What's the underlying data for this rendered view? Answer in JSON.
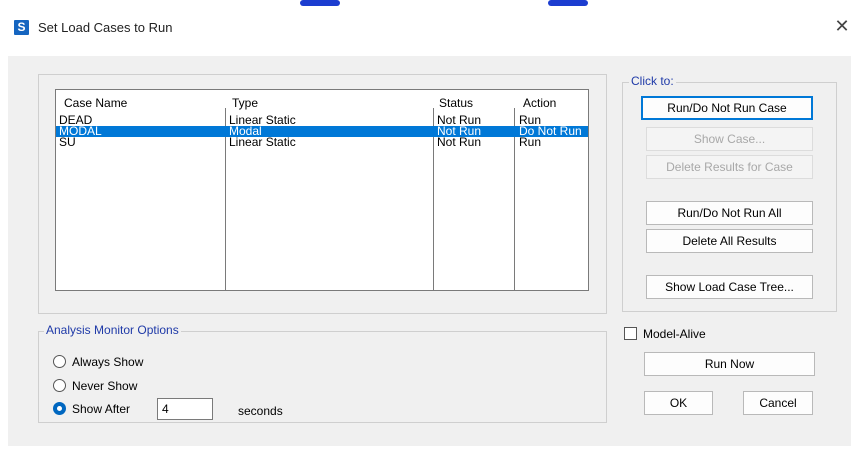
{
  "window": {
    "title": "Set Load Cases to Run",
    "app_icon_letter": "S"
  },
  "table": {
    "headers": [
      "Case Name",
      "Type",
      "Status",
      "Action"
    ],
    "rows": [
      {
        "case_name": "DEAD",
        "type": "Linear Static",
        "status": "Not Run",
        "action": "Run",
        "selected": false
      },
      {
        "case_name": "MODAL",
        "type": "Modal",
        "status": "Not Run",
        "action": "Do Not Run",
        "selected": true
      },
      {
        "case_name": "SU",
        "type": "Linear Static",
        "status": "Not Run",
        "action": "Run",
        "selected": false
      }
    ]
  },
  "click_to": {
    "label": "Click to:",
    "run_do_not_run_case": "Run/Do Not Run Case",
    "show_case": "Show Case...",
    "delete_results_for_case": "Delete Results for Case",
    "run_do_not_run_all": "Run/Do Not Run All",
    "delete_all_results": "Delete All Results",
    "show_load_case_tree": "Show Load Case Tree..."
  },
  "analysis_monitor": {
    "label": "Analysis Monitor Options",
    "always_show": "Always Show",
    "never_show": "Never Show",
    "show_after": "Show After",
    "show_after_value": "4",
    "seconds": "seconds",
    "selected_option": "show_after"
  },
  "model_alive": {
    "label": "Model-Alive",
    "checked": false
  },
  "actions": {
    "run_now": "Run Now",
    "ok": "OK",
    "cancel": "Cancel"
  },
  "colors": {
    "selection": "#0078d7",
    "group_label": "#1f3aa8",
    "app_icon": "#1565c0"
  }
}
